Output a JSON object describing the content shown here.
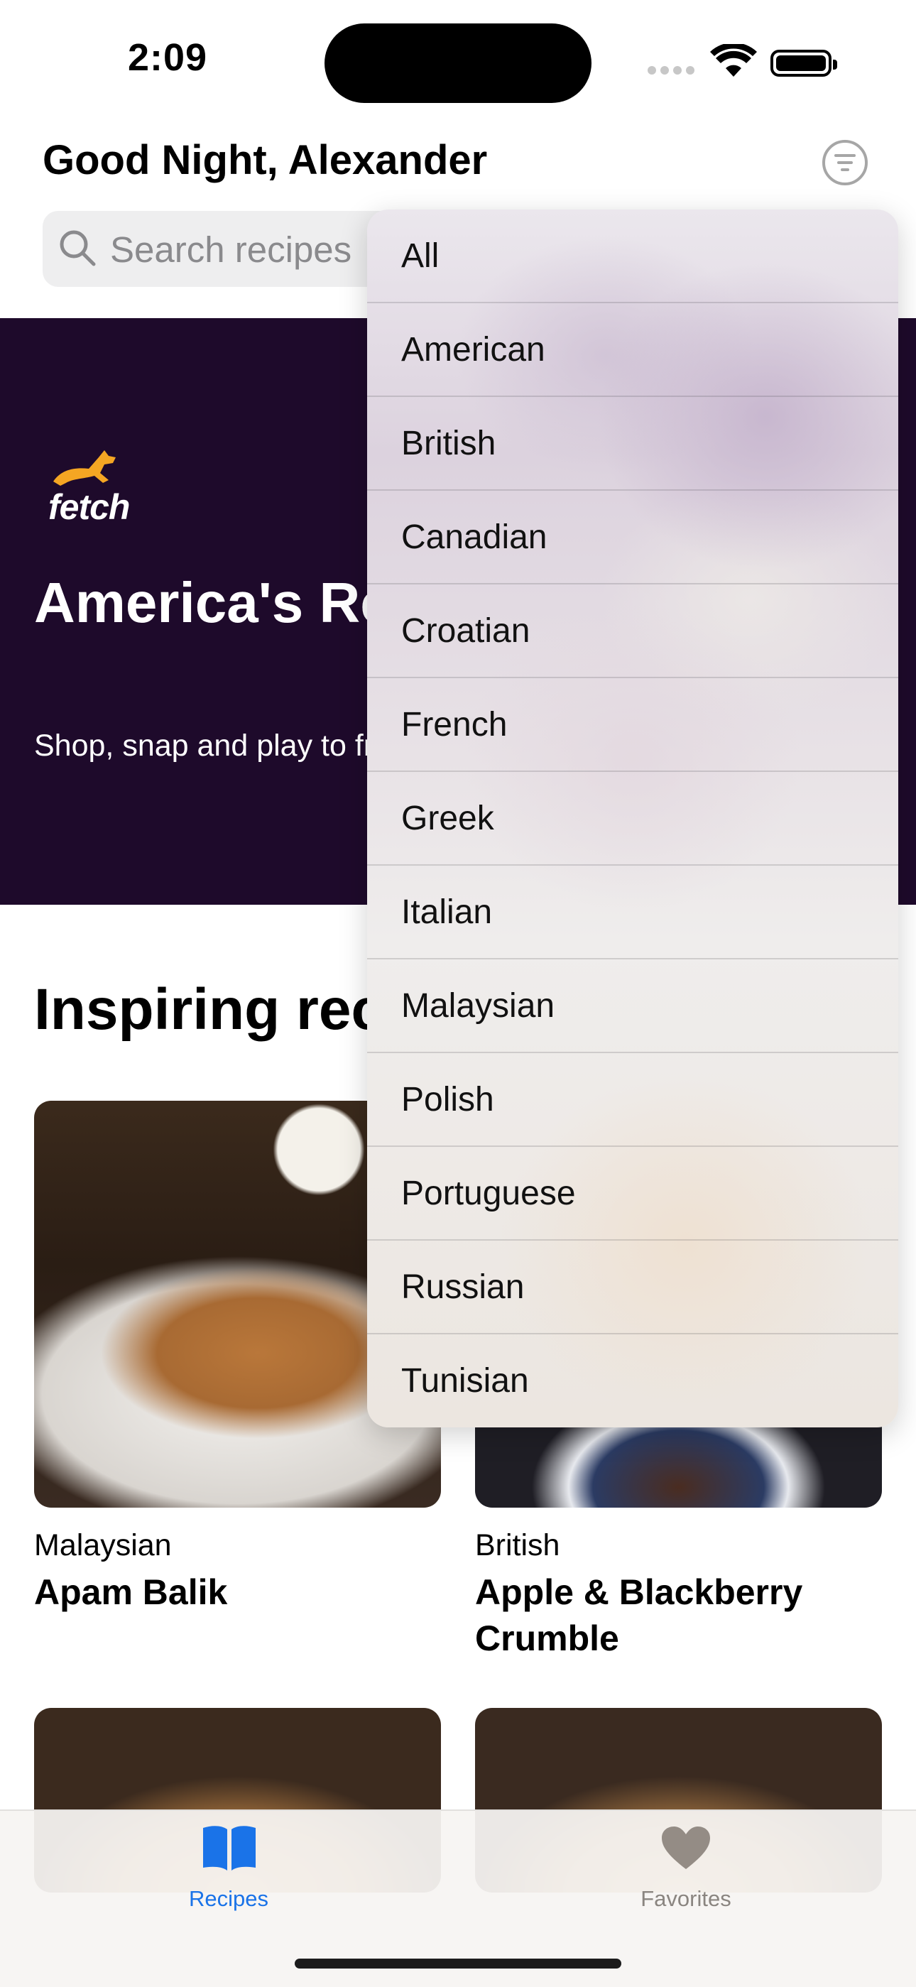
{
  "status_bar": {
    "time": "2:09"
  },
  "header": {
    "greeting": "Good Night, Alexander"
  },
  "search": {
    "placeholder": "Search recipes"
  },
  "banner": {
    "brand": "fetch",
    "title": "America's Rewards Ap",
    "subtitle": "Shop, snap and play to free gift cards with Fetc"
  },
  "section": {
    "title": "Inspiring rec"
  },
  "recipes": [
    {
      "cuisine": "Malaysian",
      "name": "Apam Balik"
    },
    {
      "cuisine": "British",
      "name": "Apple & Blackberry Crumble"
    }
  ],
  "filter_menu": {
    "items": [
      "All",
      "American",
      "British",
      "Canadian",
      "Croatian",
      "French",
      "Greek",
      "Italian",
      "Malaysian",
      "Polish",
      "Portuguese",
      "Russian",
      "Tunisian"
    ]
  },
  "tab_bar": {
    "tabs": [
      {
        "label": "Recipes",
        "icon": "book-icon",
        "active": true
      },
      {
        "label": "Favorites",
        "icon": "heart-icon",
        "active": false
      }
    ]
  },
  "colors": {
    "accent": "#1a73e8",
    "banner_bg": "#1e0a2b",
    "fetch_orange": "#f5a623"
  }
}
